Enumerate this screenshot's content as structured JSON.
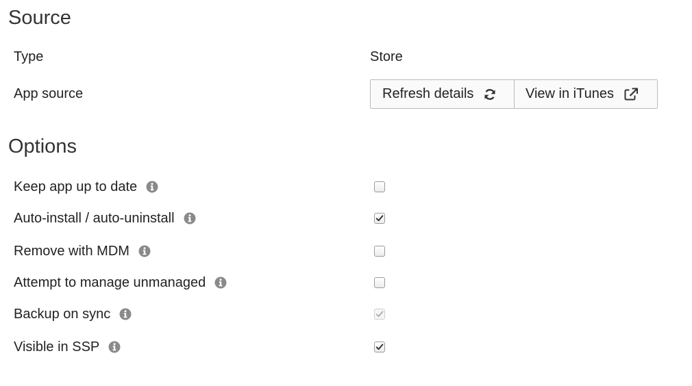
{
  "source": {
    "heading": "Source",
    "type_label": "Type",
    "type_value": "Store",
    "app_source_label": "App source",
    "refresh_button_label": "Refresh details",
    "itunes_button_label": "View in iTunes"
  },
  "options": {
    "heading": "Options",
    "items": [
      {
        "label": "Keep app up to date",
        "checked": false,
        "disabled": false
      },
      {
        "label": "Auto-install / auto-uninstall",
        "checked": true,
        "disabled": false
      },
      {
        "label": "Remove with MDM",
        "checked": false,
        "disabled": false
      },
      {
        "label": "Attempt to manage unmanaged",
        "checked": false,
        "disabled": false
      },
      {
        "label": "Backup on sync",
        "checked": true,
        "disabled": true
      },
      {
        "label": "Visible in SSP",
        "checked": true,
        "disabled": false
      }
    ]
  },
  "icons": {
    "info": "info-circle-icon",
    "refresh": "refresh-icon",
    "external_link": "external-link-icon",
    "checkmark": "checkmark-icon"
  },
  "colors": {
    "info_icon": "#8a8a8a",
    "checkmark": "#333333",
    "checkmark_disabled": "#b0b0b0",
    "button_border": "#b9b9b9"
  }
}
